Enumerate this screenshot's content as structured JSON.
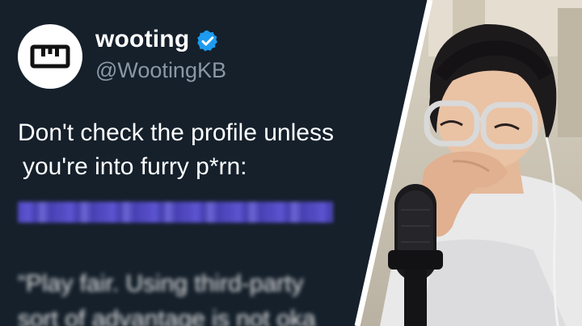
{
  "tweet": {
    "display_name": "wooting",
    "handle": "@WootingKB",
    "verified_icon": "verified-badge-icon",
    "avatar_icon": "wooting-logo-icon",
    "text_line1": "Don't check the profile unless",
    "text_line2": "you're into furry p*rn:",
    "blurred_quote_line1": "“Play fair. Using third-party",
    "blurred_quote_line2": "sort of advantage is not oka"
  },
  "colors": {
    "tweet_bg": "#15202b",
    "handle_gray": "#8b98a5",
    "verified_blue": "#1d9bf0",
    "link_purple": "#5a4ed6"
  },
  "webcam": {
    "subject": "laughing-person-with-microphone"
  }
}
